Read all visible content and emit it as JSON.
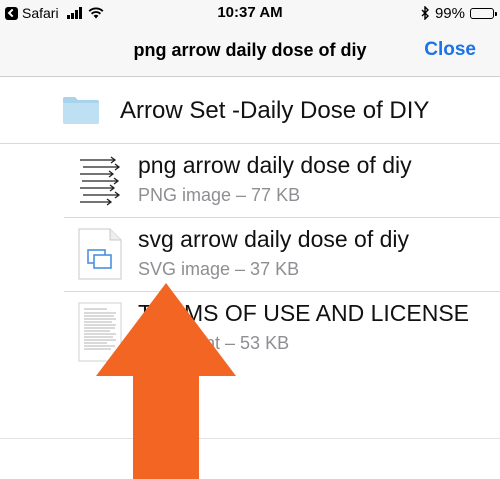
{
  "status_bar": {
    "back_app": "Safari",
    "time": "10:37 AM",
    "battery_percent_label": "99%",
    "battery_level": 0.99,
    "signal_bars": 4,
    "bluetooth_icon": "bluetooth-icon",
    "wifi_icon": "wifi-icon"
  },
  "nav": {
    "title": "png arrow daily dose of diy",
    "close_label": "Close",
    "accent_color": "#1a73e8"
  },
  "folder": {
    "label": "Arrow Set -Daily Dose of DIY",
    "icon": "folder-icon"
  },
  "files": [
    {
      "name": "png arrow daily dose of diy",
      "meta": "PNG image – 77 KB",
      "icon": "png-thumbnail-icon"
    },
    {
      "name": "svg arrow daily dose of diy",
      "meta": "SVG image – 37 KB",
      "icon": "svg-file-icon"
    },
    {
      "name": "TERMS OF USE AND LICENSE",
      "meta": "Document – 53 KB",
      "icon": "document-thumbnail-icon"
    }
  ],
  "overlay": {
    "icon": "up-arrow-icon",
    "color": "#f26522"
  }
}
